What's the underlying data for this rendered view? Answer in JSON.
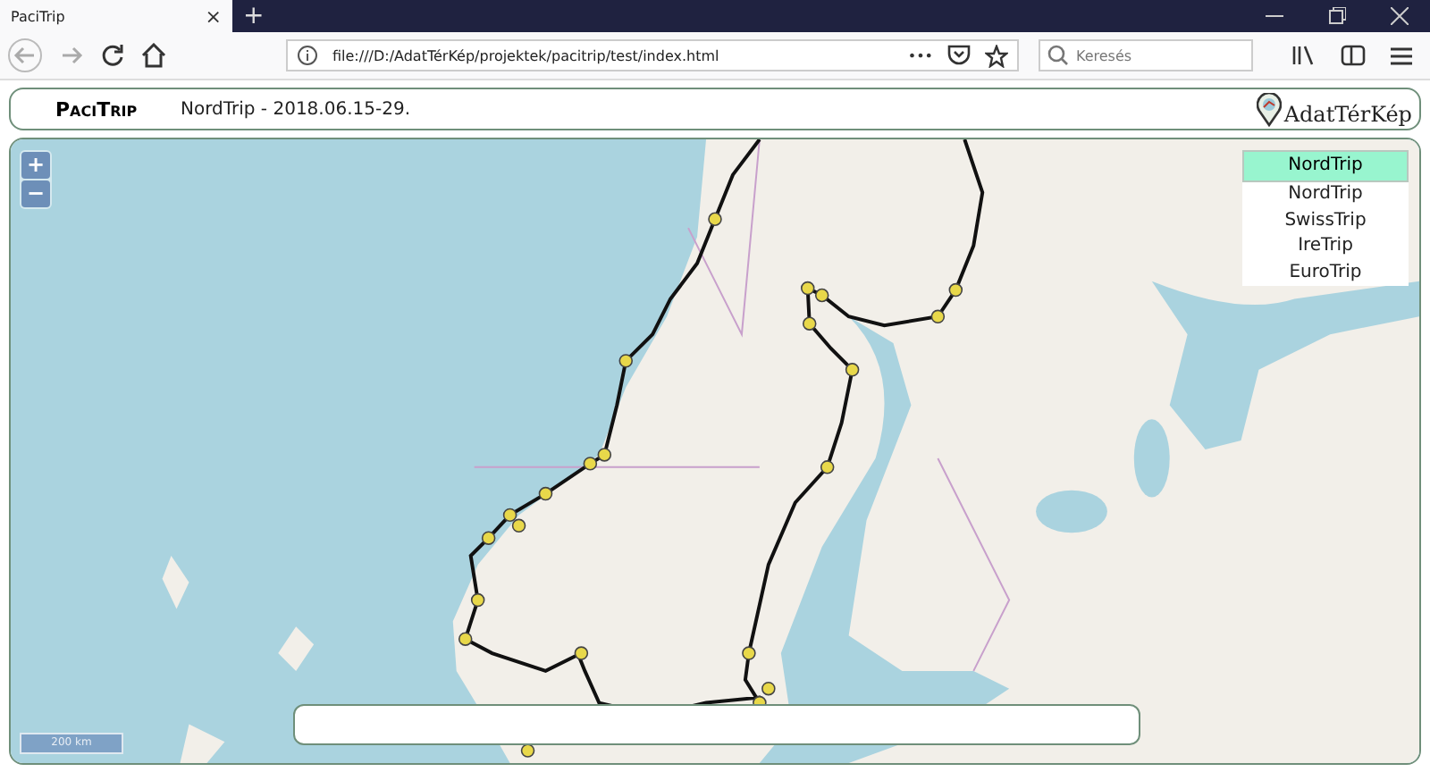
{
  "browser": {
    "tab": {
      "title": "PaciTrip",
      "close": "×"
    },
    "new_tab": "+",
    "url": "file:///D:/AdatTérKép/projektek/pacitrip/test/index.html",
    "more": "•••",
    "search": {
      "placeholder": "Keresés"
    }
  },
  "header": {
    "brand": "PaciTrip",
    "trip_title": "NordTrip - 2018.06.15-29.",
    "logo": "AdatTérKép"
  },
  "map": {
    "zoom_in": "+",
    "zoom_out": "−",
    "scale": "200 km",
    "trip_select": {
      "value": "NordTrip",
      "options": [
        {
          "label": "NordTrip"
        },
        {
          "label": "SwissTrip"
        },
        {
          "label": "IreTrip"
        },
        {
          "label": "EuroTrip"
        }
      ]
    }
  }
}
